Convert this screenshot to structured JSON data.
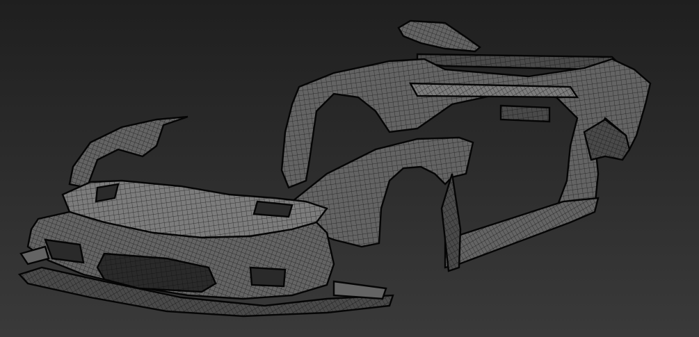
{
  "viewport": {
    "background_top": "#1f1f1f",
    "background_bottom": "#3a3a3a",
    "model_color": "#6e6e6e",
    "wire_color": "#0c0c0c",
    "display_mode": "wireframe-on-shaded"
  },
  "model": {
    "parts": [
      "front-bumper",
      "hood",
      "front-left-fender",
      "front-right-fender",
      "windshield-frame",
      "roof-spoiler",
      "rear-bumper",
      "rear-fender",
      "side-skirt"
    ]
  }
}
